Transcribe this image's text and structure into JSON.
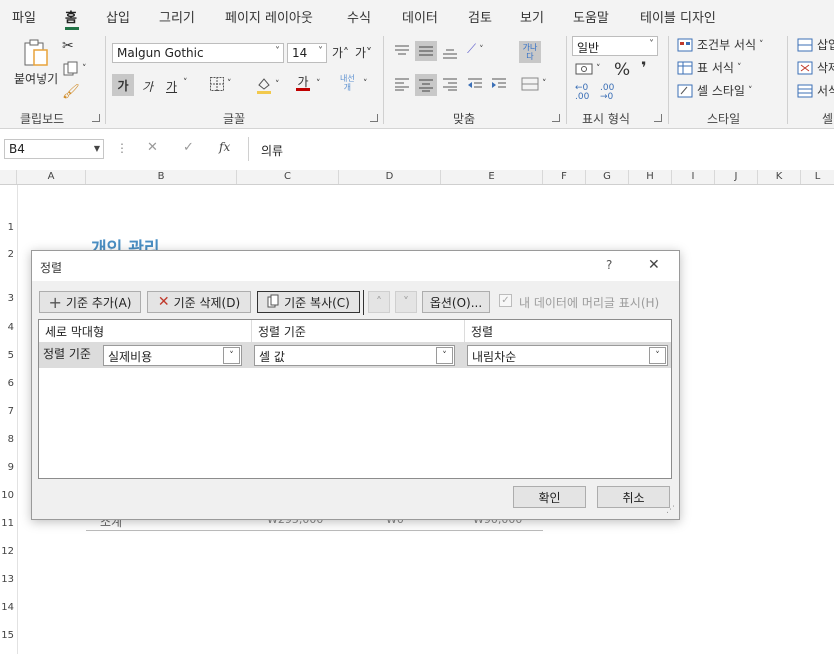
{
  "menu": {
    "tabs": [
      "파일",
      "홈",
      "삽입",
      "그리기",
      "페이지 레이아웃",
      "수식",
      "데이터",
      "검토",
      "보기",
      "도움말",
      "테이블 디자인"
    ],
    "active_tab": "홈"
  },
  "ribbon": {
    "clipboard": {
      "paste": "붙여넣기",
      "label": "클립보드"
    },
    "font": {
      "name": "Malgun Gothic",
      "size": "14",
      "bold": "가",
      "italic": "가",
      "underline": "가",
      "grow": "가˄",
      "shrink": "가˅",
      "phonetic": "내선\n개",
      "label": "글꼴"
    },
    "alignment": {
      "label": "맞춤",
      "wrap": "가나\n다"
    },
    "number": {
      "format": "일반",
      "percent": "%",
      "comma": "❜",
      "label": "표시 형식"
    },
    "styles": {
      "conditional": "조건부 서식",
      "table_format": "표 서식",
      "cell_style": "셀 스타일",
      "label": "스타일"
    },
    "cells": {
      "insert": "삽입",
      "delete": "삭제",
      "format": "서식",
      "label": "셀"
    }
  },
  "formula_bar": {
    "name_box": "B4",
    "cancel": "✕",
    "enter": "✓",
    "fx": "fx",
    "value": "의류"
  },
  "sheet": {
    "columns": [
      "A",
      "B",
      "C",
      "D",
      "E",
      "F",
      "G",
      "H",
      "I",
      "J",
      "K",
      "L"
    ],
    "rows": [
      "1",
      "2",
      "3",
      "4",
      "5",
      "6",
      "7",
      "8",
      "9",
      "10",
      "11",
      "12",
      "13",
      "14",
      "15"
    ],
    "title": "개인 관리",
    "row11": {
      "b": "소계",
      "c": "₩295,000",
      "d": "₩0",
      "e": "₩90,000"
    }
  },
  "dialog": {
    "title": "정렬",
    "help": "?",
    "close": "✕",
    "buttons": {
      "add_level": "기준 추가(A)",
      "delete_level": "기준 삭제(D)",
      "copy_level": "기준 복사(C)",
      "move_up": "˄",
      "move_down": "˅",
      "options": "옵션(O)...",
      "header_checkbox": "내 데이터에 머리글 표시(H)"
    },
    "headers": {
      "column": "세로 막대형",
      "sort_on": "정렬 기준",
      "order": "정렬"
    },
    "row": {
      "label": "정렬 기준",
      "column": "실제비용",
      "sort_on": "셀 값",
      "order": "내림차순"
    },
    "ok": "확인",
    "cancel": "취소"
  }
}
